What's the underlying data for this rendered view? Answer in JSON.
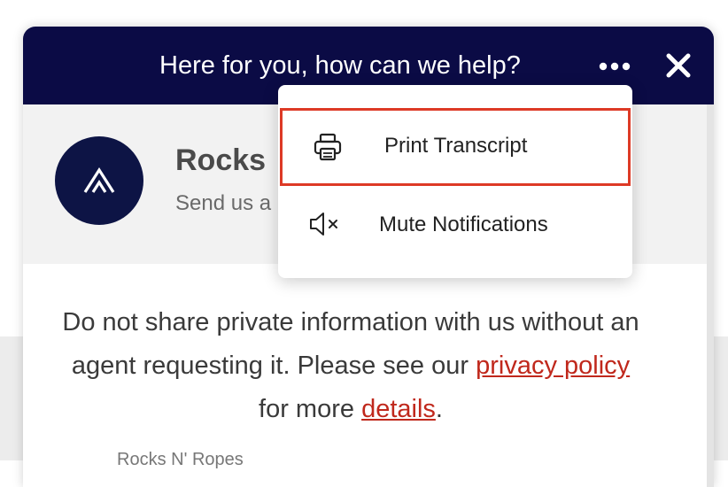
{
  "header": {
    "title": "Here for you, how can we help?",
    "more_icon": "more-horizontal-icon",
    "close_icon": "close-icon",
    "background": "#0b0b45"
  },
  "agent": {
    "name": "Rocks",
    "subtitle": "Send us a",
    "avatar_icon": "brand-logo-icon",
    "avatar_color": "#0d1445"
  },
  "menu": {
    "items": [
      {
        "label": "Print Transcript",
        "icon": "printer-icon",
        "selected": true
      },
      {
        "label": "Mute Notifications",
        "icon": "speaker-mute-icon",
        "selected": false
      }
    ],
    "highlight_color": "#dd3a26"
  },
  "notice": {
    "text_before": "Do not share private information with us without an agent requesting it. Please see our",
    "link_privacy": "privacy policy",
    "text_middle": "for more",
    "link_details": "details",
    "text_after": ".",
    "link_color": "#c0281c"
  },
  "footer": {
    "brand": "Rocks N' Ropes"
  }
}
